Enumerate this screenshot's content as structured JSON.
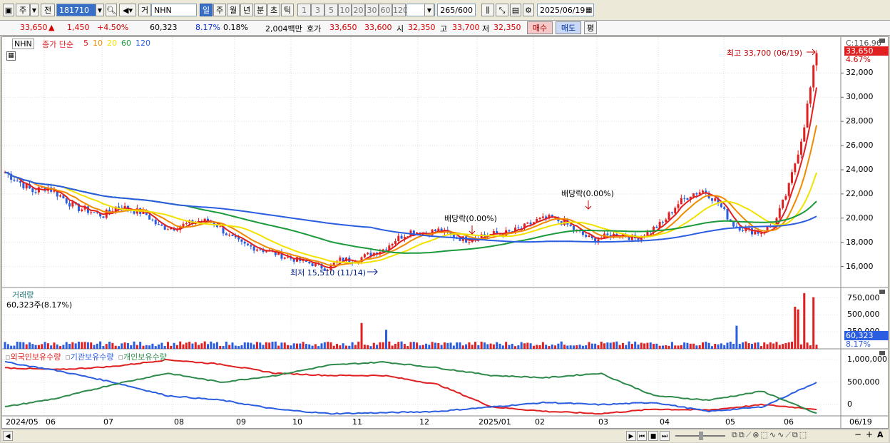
{
  "toolbar": {
    "chart_type": "주",
    "prev_label": "전",
    "code": "181710",
    "market_label": "거",
    "stock_name": "NHN",
    "periods": [
      "일",
      "주",
      "월",
      "년",
      "분",
      "초",
      "틱"
    ],
    "selected_period": "일",
    "intervals": [
      "1",
      "3",
      "5",
      "10",
      "20",
      "30",
      "60",
      "120"
    ],
    "bar_count": "265/600",
    "date": "2025/06/19"
  },
  "quote": {
    "price": "33,650",
    "change_sign": "▲",
    "change": "1,450",
    "change_pct": "+4.50%",
    "volume": "60,323",
    "turnover_pct": "8.17%",
    "extra_pct": "0.18%",
    "amount": "2,004백만",
    "bid_label": "호가",
    "ask": "33,650",
    "bid": "33,600",
    "open_label": "시",
    "open": "32,350",
    "high_label": "고",
    "high": "33,700",
    "low_label": "저",
    "low": "32,350",
    "buy_button": "매수",
    "sell_button": "매도",
    "eval_button": "평"
  },
  "price_panel": {
    "name_label": "NHN",
    "ma_title": "종가 단순",
    "ma_periods": [
      "5",
      "10",
      "20",
      "60",
      "120"
    ],
    "ma_colors": [
      "#e02020",
      "#f08a00",
      "#f2e200",
      "#1a9a3a",
      "#2a5de0"
    ],
    "c_label": "C:116.96",
    "current_box": "33,650",
    "change_box": "4.67%",
    "y_ticks": [
      "32,000",
      "30,000",
      "28,000",
      "26,000",
      "24,000",
      "22,000",
      "20,000",
      "18,000",
      "16,000"
    ],
    "high_note": "최고 33,700 (06/19)",
    "low_note": "최저 15,510 (11/14)",
    "dividend_1": "배당락(0.00%)",
    "dividend_2": "배당락(0.00%)"
  },
  "volume_panel": {
    "title": "거래량",
    "current": "60,323주(8.17%)",
    "y_ticks": [
      "750,000",
      "500,000",
      "250,000"
    ],
    "current_box": "60,323",
    "pct_box": "8.17%"
  },
  "holding_panel": {
    "legend": [
      "외국인보유수량",
      "기관보유수량",
      "개인보유수량"
    ],
    "legend_colors": [
      "#e02020",
      "#2a5de0",
      "#2d8a4a"
    ],
    "y_ticks": [
      "1,000,000",
      "500,000",
      "0"
    ]
  },
  "x_axis": {
    "labels": [
      "2024/05",
      "06",
      "07",
      "08",
      "09",
      "10",
      "11",
      "12",
      "2025/01",
      "02",
      "03",
      "04",
      "05",
      "06"
    ],
    "right_label": "06/19"
  },
  "chart_data": {
    "type": "candlestick",
    "price_ylim": [
      14500,
      34500
    ],
    "price_close_approx": [
      23800,
      23000,
      22200,
      22600,
      21800,
      20900,
      20600,
      20200,
      21000,
      20700,
      20400,
      19300,
      19200,
      19500,
      19800,
      19600,
      18500,
      17800,
      17500,
      17200,
      16800,
      16500,
      16200,
      15800,
      16600,
      16500,
      17000,
      17400,
      18300,
      18900,
      18800,
      19000,
      18500,
      18200,
      18600,
      18700,
      18800,
      19200,
      19800,
      20000,
      19600,
      18800,
      18200,
      18500,
      18700,
      18300,
      18900,
      19600,
      21100,
      22000,
      22300,
      21200,
      19500,
      19000,
      18800,
      19500,
      22500,
      27000,
      33650
    ],
    "volume_ylim": [
      0,
      850000
    ],
    "highlight_volumes": [
      620000,
      580000,
      820000,
      760000
    ],
    "holding_ylim": [
      -250000,
      1100000
    ]
  }
}
